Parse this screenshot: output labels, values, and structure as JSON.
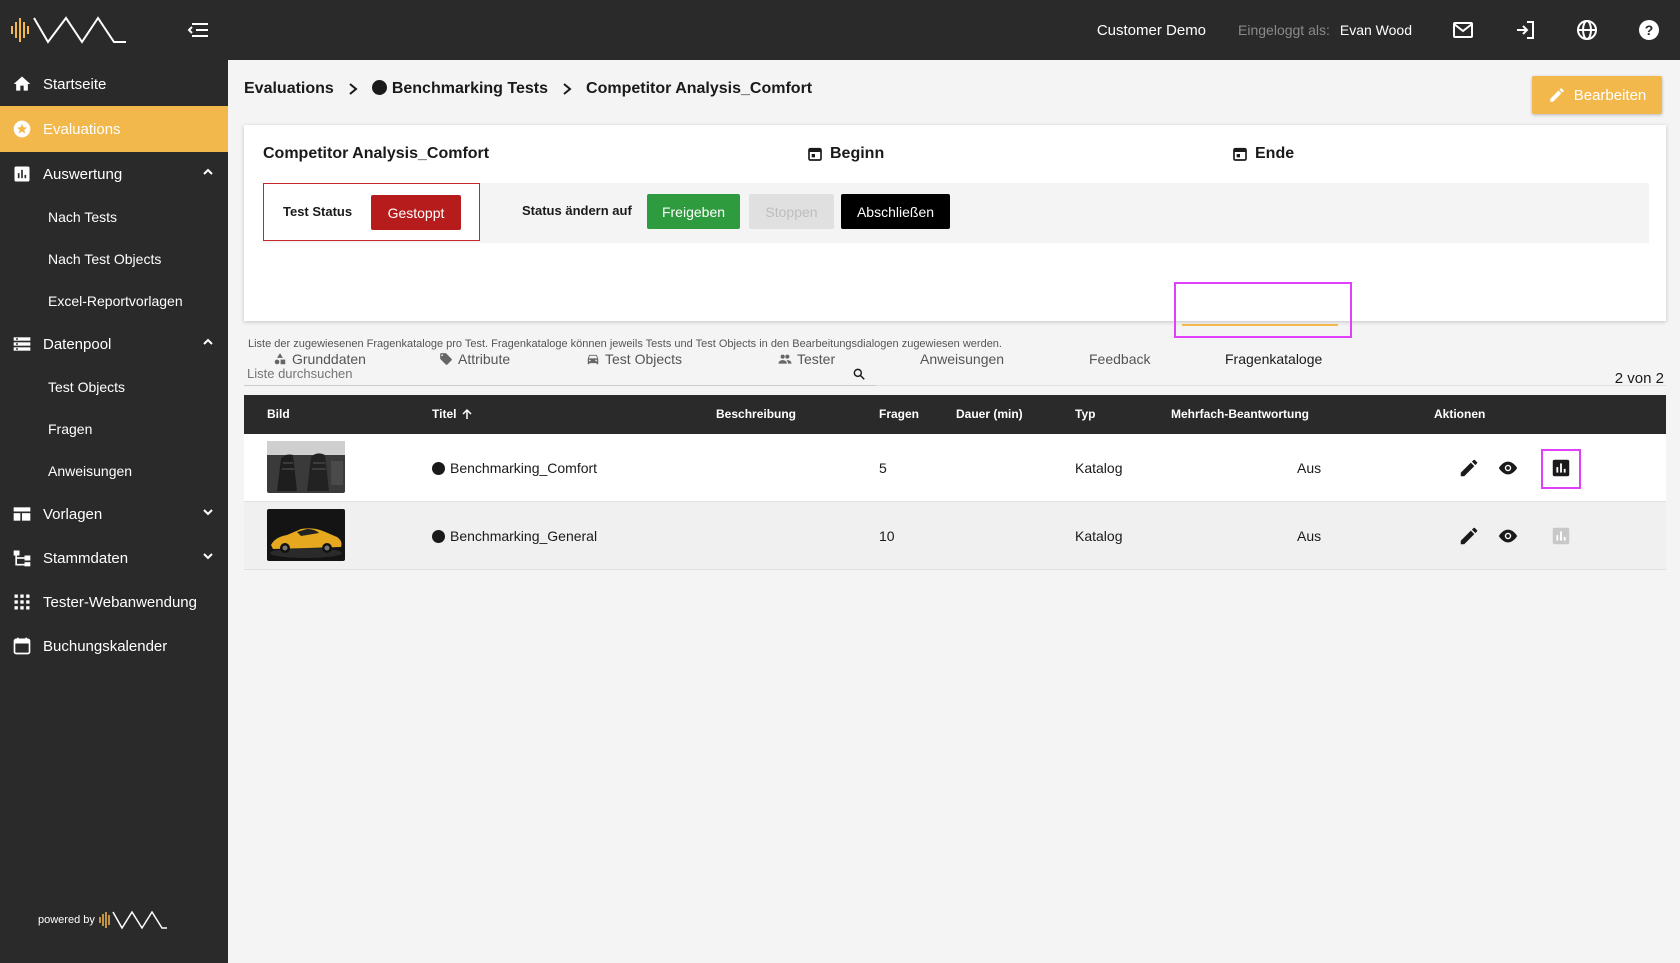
{
  "colors": {
    "accent": "#f2b84b",
    "dark": "#2a2a2a",
    "danger": "#b71c1c",
    "success": "#2e9b3e",
    "highlight": "#e040fb"
  },
  "header": {
    "customer": "Customer Demo",
    "login_label": "Eingeloggt als:",
    "user": "Evan Wood",
    "icons": [
      "mail-icon",
      "logout-icon",
      "globe-icon",
      "help-icon"
    ]
  },
  "sidebar": {
    "items": [
      {
        "label": "Startseite",
        "icon": "home-icon"
      },
      {
        "label": "Evaluations",
        "icon": "star-icon",
        "active": true
      },
      {
        "label": "Auswertung",
        "icon": "chart-icon",
        "expanded": true
      },
      {
        "label": "Nach Tests"
      },
      {
        "label": "Nach Test Objects"
      },
      {
        "label": "Excel-Reportvorlagen"
      },
      {
        "label": "Datenpool",
        "icon": "list-icon",
        "expanded": true
      },
      {
        "label": "Test Objects"
      },
      {
        "label": "Fragen"
      },
      {
        "label": "Anweisungen"
      },
      {
        "label": "Vorlagen",
        "icon": "template-icon",
        "expanded": false
      },
      {
        "label": "Stammdaten",
        "icon": "hierarchy-icon",
        "expanded": false
      },
      {
        "label": "Tester-Webanwendung",
        "icon": "grid-icon"
      },
      {
        "label": "Buchungskalender",
        "icon": "calendar-icon"
      }
    ],
    "powered_by": "powered by"
  },
  "breadcrumb": [
    "Evaluations",
    "Benchmarking Tests",
    "Competitor Analysis_Comfort"
  ],
  "edit_button": "Bearbeiten",
  "card": {
    "title": "Competitor Analysis_Comfort",
    "begin_label": "Beginn",
    "end_label": "Ende",
    "status_label": "Test Status",
    "status_value": "Gestoppt",
    "change_label": "Status ändern auf",
    "btn_release": "Freigeben",
    "btn_stop": "Stoppen",
    "btn_close": "Abschließen"
  },
  "tabs": [
    {
      "label": "Grunddaten",
      "icon": "shapes-icon"
    },
    {
      "label": "Attribute",
      "icon": "tag-icon"
    },
    {
      "label": "Test Objects",
      "icon": "car-icon"
    },
    {
      "label": "Tester",
      "icon": "people-icon"
    },
    {
      "label": "Anweisungen"
    },
    {
      "label": "Feedback"
    },
    {
      "label": "Fragenkataloge",
      "active": true
    }
  ],
  "hint": "Liste der zugewiesenen Fragenkataloge pro Test. Fragenkataloge können jeweils Tests und Test Objects in den Bearbeitungsdialogen zugewiesen werden.",
  "search": {
    "placeholder": "Liste durchsuchen"
  },
  "count": "2 von 2",
  "table": {
    "columns": [
      "Bild",
      "Titel",
      "Beschreibung",
      "Fragen",
      "Dauer (min)",
      "Typ",
      "Mehrfach-Beantwortung",
      "Aktionen"
    ],
    "rows": [
      {
        "title": "Benchmarking_Comfort",
        "description": "",
        "questions": "5",
        "duration": "",
        "type": "Katalog",
        "multi": "Aus",
        "image": "car-seats-photo"
      },
      {
        "title": "Benchmarking_General",
        "description": "",
        "questions": "10",
        "duration": "",
        "type": "Katalog",
        "multi": "Aus",
        "image": "yellow-sports-car-photo"
      }
    ]
  }
}
